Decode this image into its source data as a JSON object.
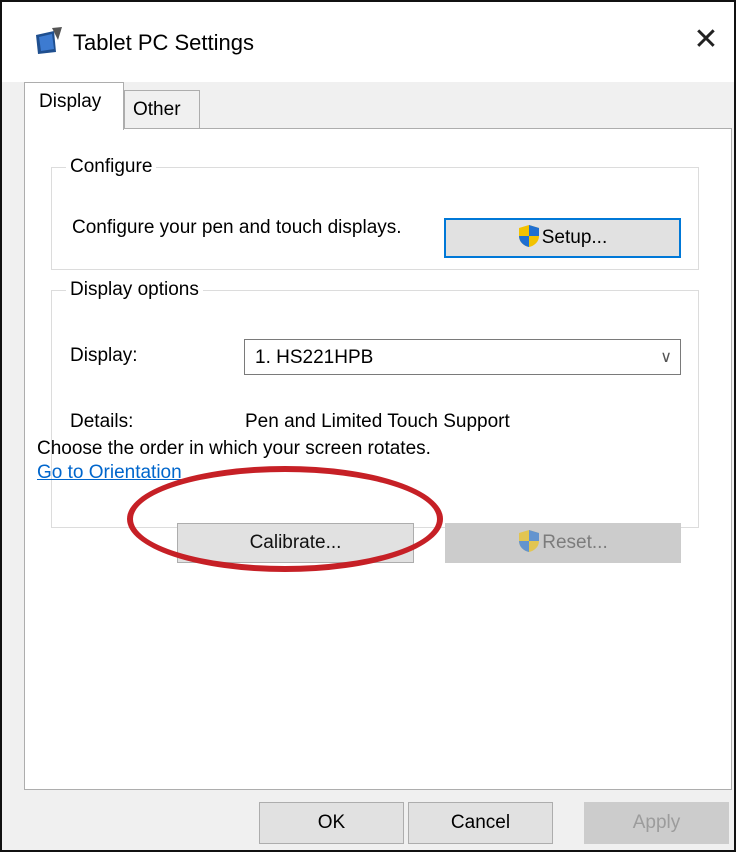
{
  "window": {
    "title": "Tablet PC Settings",
    "close_symbol": "✕"
  },
  "tabs": [
    {
      "label": "Display"
    },
    {
      "label": "Other"
    }
  ],
  "configure": {
    "legend": "Configure",
    "description": "Configure your pen and touch displays.",
    "setup_label": "Setup..."
  },
  "display_options": {
    "legend": "Display options",
    "display_label": "Display:",
    "display_value": "1. HS221HPB",
    "details_label": "Details:",
    "details_value": "Pen and Limited Touch Support",
    "calibrate_label": "Calibrate...",
    "reset_label": "Reset..."
  },
  "orientation": {
    "text": "Choose the order in which your screen rotates.",
    "link": "Go to Orientation"
  },
  "footer": {
    "ok": "OK",
    "cancel": "Cancel",
    "apply": "Apply"
  },
  "colors": {
    "annotation": "#c62026",
    "link": "#0066cc",
    "focus": "#0078d7"
  },
  "icons": {
    "app": "tablet-pen-icon",
    "shield": "uac-shield-icon",
    "close": "close-icon",
    "dropdown": "chevron-down-icon"
  }
}
